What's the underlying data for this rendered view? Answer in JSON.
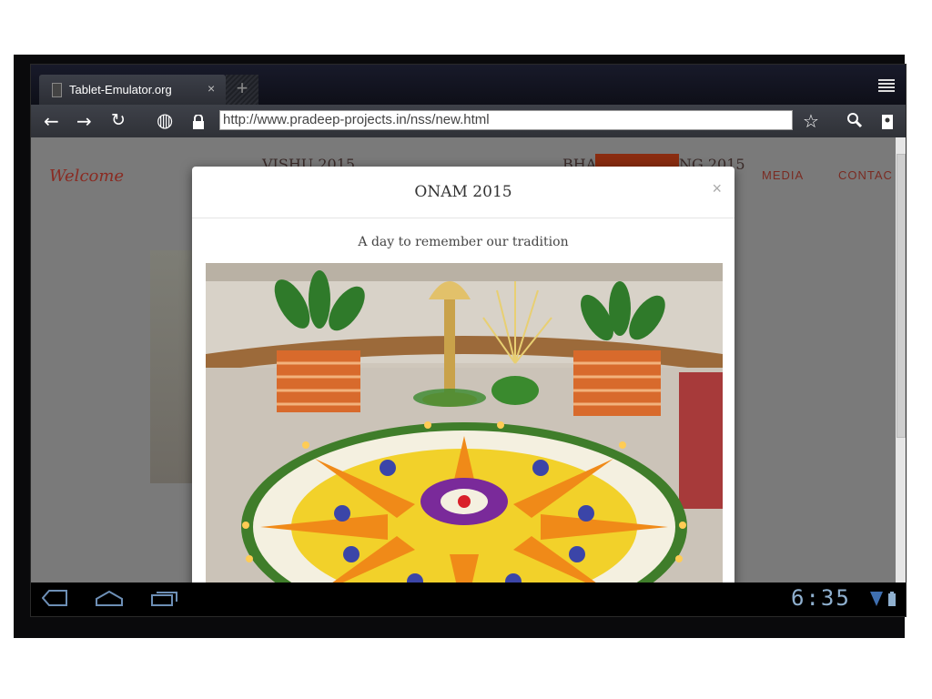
{
  "browser": {
    "tab_title": "Tablet-Emulator.org",
    "tab_close": "×",
    "new_tab": "+",
    "url": "http://www.pradeep-projects.in/nss/new.html"
  },
  "site_nav": {
    "welcome": "Welcome",
    "item1": "VISHU 2015",
    "item2": "BHA",
    "item2_tail": "NG 2015",
    "media": "MEDIA",
    "contact": "CONTAC"
  },
  "modal": {
    "title": "ONAM 2015",
    "close": "×",
    "subtitle": "A day to remember our tradition"
  },
  "system": {
    "clock": "6:35"
  },
  "icons": [
    "back-arrow-icon",
    "forward-arrow-icon",
    "reload-icon",
    "globe-icon",
    "lock-icon",
    "star-icon",
    "search-icon",
    "bookmark-icon",
    "menu-icon",
    "nav-back-icon",
    "home-icon",
    "recent-apps-icon",
    "wifi-icon",
    "battery-icon"
  ]
}
